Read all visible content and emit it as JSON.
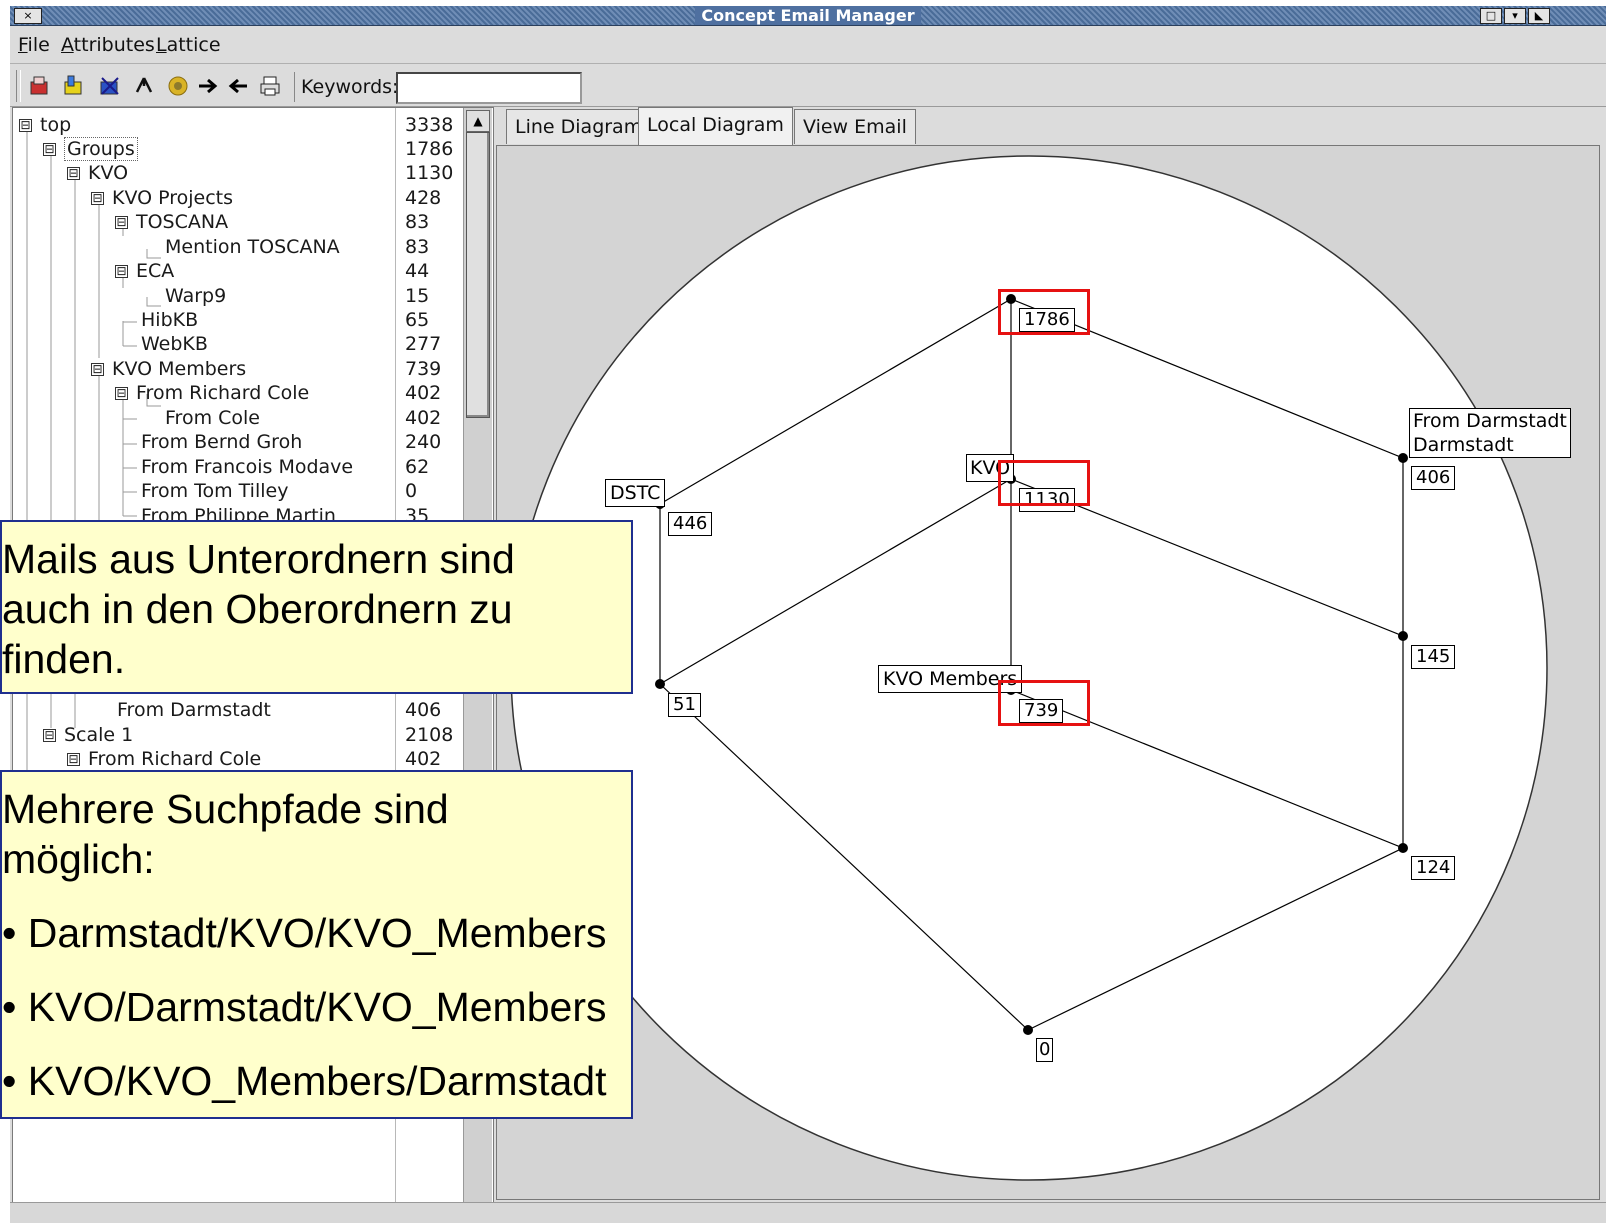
{
  "window": {
    "title": "Concept Email Manager",
    "buttons": {
      "close": "×",
      "restore": "□",
      "menu": "▾",
      "shade": "◣"
    }
  },
  "menu": [
    "File",
    "Attributes",
    "Lattice"
  ],
  "toolbar": {
    "icons": [
      "mailbox-red-icon",
      "mailbox-yellow-icon",
      "mailbox-blue-icon",
      "tree-icon",
      "orb-icon",
      "right-arrow-icon",
      "left-arrow-icon",
      "printer-icon"
    ],
    "keywords_label": "Keywords:",
    "keywords_value": ""
  },
  "tree": [
    {
      "label": "top",
      "count": "3338",
      "toggle": "⊟"
    },
    {
      "label": "Groups",
      "count": "1786",
      "toggle": "⊟"
    },
    {
      "label": "KVO",
      "count": "1130",
      "toggle": "⊟"
    },
    {
      "label": "KVO Projects",
      "count": "428",
      "toggle": "⊟"
    },
    {
      "label": "TOSCANA",
      "count": "83",
      "toggle": "⊟"
    },
    {
      "label": "Mention TOSCANA",
      "count": "83",
      "toggle": ""
    },
    {
      "label": "ECA",
      "count": "44",
      "toggle": "⊟"
    },
    {
      "label": "Warp9",
      "count": "15",
      "toggle": ""
    },
    {
      "label": "HibKB",
      "count": "65",
      "toggle": ""
    },
    {
      "label": "WebKB",
      "count": "277",
      "toggle": ""
    },
    {
      "label": "KVO Members",
      "count": "739",
      "toggle": "⊟"
    },
    {
      "label": "From Richard Cole",
      "count": "402",
      "toggle": "⊟"
    },
    {
      "label": "From Cole",
      "count": "402",
      "toggle": ""
    },
    {
      "label": "From Bernd Groh",
      "count": "240",
      "toggle": ""
    },
    {
      "label": "From Francois Modave",
      "count": "62",
      "toggle": ""
    },
    {
      "label": "From Tom Tilley",
      "count": "0",
      "toggle": ""
    },
    {
      "label": "From Philippe Martin",
      "count": "35",
      "toggle": ""
    },
    {
      "label": "From Darmstadt",
      "count": "406",
      "toggle": ""
    },
    {
      "label": "Scale 1",
      "count": "2108",
      "toggle": "⊟"
    },
    {
      "label": "From Richard Cole",
      "count": "402",
      "toggle": "⊟"
    }
  ],
  "tabs": [
    "Line Diagram",
    "Local Diagram",
    "View Email"
  ],
  "active_tab": "Local Diagram",
  "diagram": {
    "node_counts": [
      "1786",
      "1130",
      "739",
      "446",
      "51",
      "406",
      "145",
      "124",
      "0"
    ],
    "labels": {
      "dstc": "DSTC",
      "kvo": "KVO",
      "kvo_members": "KVO Members",
      "from_darmstadt_1": "From Darmstadt",
      "from_darmstadt_2": "Darmstadt"
    },
    "highlight_color": "#e61111"
  },
  "callouts": {
    "top": {
      "lines": [
        "Mails aus Unterordnern sind",
        "auch in den Oberordnern zu",
        "finden."
      ]
    },
    "bottom": {
      "lines": [
        "Mehrere Suchpfade sind",
        "möglich:"
      ],
      "bullets": [
        "• Darmstadt/KVO/KVO_Members",
        "• KVO/Darmstadt/KVO_Members",
        "• KVO/KVO_Members/Darmstadt"
      ]
    }
  }
}
